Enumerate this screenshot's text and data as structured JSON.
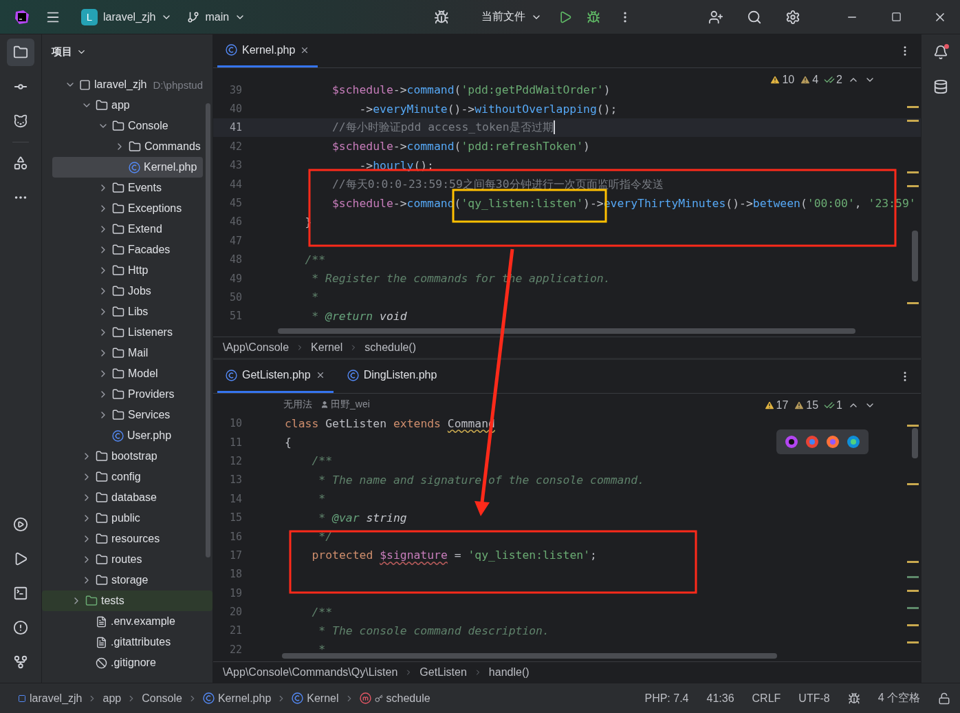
{
  "title_bar": {
    "project_badge": "L",
    "project": "laravel_zjh",
    "branch": "main",
    "run_config": "当前文件"
  },
  "project_panel": {
    "title": "项目",
    "tree": [
      {
        "name": "laravel_zjh",
        "path": "D:\\phpstud",
        "kind": "module",
        "expanded": true,
        "selected": false,
        "children": [
          {
            "name": "app",
            "kind": "folder",
            "expanded": true,
            "selected": false,
            "children": [
              {
                "name": "Console",
                "kind": "folder",
                "expanded": true,
                "selected": false,
                "children": [
                  {
                    "name": "Commands",
                    "kind": "folder",
                    "expanded": false,
                    "selected": false
                  },
                  {
                    "name": "Kernel.php",
                    "kind": "php-class",
                    "selected": true
                  }
                ]
              },
              {
                "name": "Events",
                "kind": "folder",
                "expanded": false,
                "selected": false
              },
              {
                "name": "Exceptions",
                "kind": "folder",
                "expanded": false,
                "selected": false
              },
              {
                "name": "Extend",
                "kind": "folder",
                "expanded": false,
                "selected": false
              },
              {
                "name": "Facades",
                "kind": "folder",
                "expanded": false,
                "selected": false
              },
              {
                "name": "Http",
                "kind": "folder",
                "expanded": false,
                "selected": false
              },
              {
                "name": "Jobs",
                "kind": "folder",
                "expanded": false,
                "selected": false
              },
              {
                "name": "Libs",
                "kind": "folder",
                "expanded": false,
                "selected": false
              },
              {
                "name": "Listeners",
                "kind": "folder",
                "expanded": false,
                "selected": false
              },
              {
                "name": "Mail",
                "kind": "folder",
                "expanded": false,
                "selected": false
              },
              {
                "name": "Model",
                "kind": "folder",
                "expanded": false,
                "selected": false
              },
              {
                "name": "Providers",
                "kind": "folder",
                "expanded": false,
                "selected": false
              },
              {
                "name": "Services",
                "kind": "folder",
                "expanded": false,
                "selected": false
              },
              {
                "name": "User.php",
                "kind": "php-class",
                "selected": false
              }
            ]
          },
          {
            "name": "bootstrap",
            "kind": "folder",
            "expanded": false,
            "selected": false
          },
          {
            "name": "config",
            "kind": "folder",
            "expanded": false,
            "selected": false
          },
          {
            "name": "database",
            "kind": "folder",
            "expanded": false,
            "selected": false
          },
          {
            "name": "public",
            "kind": "folder",
            "expanded": false,
            "selected": false
          },
          {
            "name": "resources",
            "kind": "folder",
            "expanded": false,
            "selected": false
          },
          {
            "name": "routes",
            "kind": "folder",
            "expanded": false,
            "selected": false
          },
          {
            "name": "storage",
            "kind": "folder",
            "expanded": false,
            "selected": false
          },
          {
            "name": "tests",
            "kind": "test-folder",
            "expanded": false,
            "selected": false
          },
          {
            "name": ".env.example",
            "kind": "text",
            "selected": false
          },
          {
            "name": ".gitattributes",
            "kind": "text",
            "selected": false
          },
          {
            "name": ".gitignore",
            "kind": "ignore",
            "selected": false
          }
        ]
      }
    ]
  },
  "editors": [
    {
      "tabs": [
        {
          "label": "Kernel.php",
          "selected": true
        }
      ],
      "inspections": {
        "warnings": "10",
        "weak_warnings": "4",
        "typos": "2"
      },
      "lines": [
        {
          "n": "39",
          "current": false,
          "tokens": [
            {
              "kind": "var",
              "t": "        $schedule"
            },
            {
              "kind": "plain",
              "t": "->"
            },
            {
              "kind": "method",
              "t": "command"
            },
            {
              "kind": "plain",
              "t": "("
            },
            {
              "kind": "string",
              "t": "'pdd:getPddWaitOrder'"
            },
            {
              "kind": "plain",
              "t": ")"
            }
          ]
        },
        {
          "n": "40",
          "current": false,
          "tokens": [
            {
              "kind": "plain",
              "t": "            ->"
            },
            {
              "kind": "method",
              "t": "everyMinute"
            },
            {
              "kind": "plain",
              "t": "()->"
            },
            {
              "kind": "method",
              "t": "withoutOverlapping"
            },
            {
              "kind": "plain",
              "t": "();"
            }
          ]
        },
        {
          "n": "41",
          "current": true,
          "tokens": [
            {
              "kind": "comment",
              "t": "        //每小时验证pdd access_token是否过期"
            }
          ]
        },
        {
          "n": "42",
          "current": false,
          "tokens": [
            {
              "kind": "var",
              "t": "        $schedule"
            },
            {
              "kind": "plain",
              "t": "->"
            },
            {
              "kind": "method",
              "t": "command"
            },
            {
              "kind": "plain",
              "t": "("
            },
            {
              "kind": "string",
              "t": "'pdd:refreshToken'"
            },
            {
              "kind": "plain",
              "t": ")"
            }
          ]
        },
        {
          "n": "43",
          "current": false,
          "tokens": [
            {
              "kind": "plain",
              "t": "            ->"
            },
            {
              "kind": "method",
              "t": "hourly"
            },
            {
              "kind": "plain",
              "t": "();"
            }
          ]
        },
        {
          "n": "44",
          "current": false,
          "tokens": [
            {
              "kind": "comment",
              "t": "        //每天0:0:0-23:59:59之间每30分钟进行一次页面监听指令发送"
            }
          ]
        },
        {
          "n": "45",
          "current": false,
          "tokens": [
            {
              "kind": "var",
              "t": "        $schedule"
            },
            {
              "kind": "plain",
              "t": "->"
            },
            {
              "kind": "method",
              "t": "command"
            },
            {
              "kind": "plain",
              "t": "("
            },
            {
              "kind": "string",
              "t": "'qy_listen:listen'"
            },
            {
              "kind": "plain",
              "t": ")->"
            },
            {
              "kind": "method",
              "t": "everyThirtyMinutes"
            },
            {
              "kind": "plain",
              "t": "()->"
            },
            {
              "kind": "method",
              "t": "between"
            },
            {
              "kind": "plain",
              "t": "("
            },
            {
              "kind": "string",
              "t": "'00:00'"
            },
            {
              "kind": "plain",
              "t": ", "
            },
            {
              "kind": "string",
              "t": "'23:59'"
            }
          ]
        },
        {
          "n": "46",
          "current": false,
          "tokens": [
            {
              "kind": "plain",
              "t": "    }"
            }
          ]
        },
        {
          "n": "47",
          "current": false
        },
        {
          "n": "48",
          "current": false,
          "tokens": [
            {
              "kind": "doc",
              "t": "    /**"
            }
          ]
        },
        {
          "n": "49",
          "current": false,
          "tokens": [
            {
              "kind": "doc",
              "t": "     * Register the commands for the application."
            }
          ]
        },
        {
          "n": "50",
          "current": false,
          "tokens": [
            {
              "kind": "doc",
              "t": "     *"
            }
          ]
        },
        {
          "n": "51",
          "current": false,
          "tokens": [
            {
              "kind": "doc",
              "t": "     * "
            },
            {
              "kind": "doctag",
              "t": "@return"
            },
            {
              "kind": "doctype",
              "t": " void"
            }
          ]
        }
      ],
      "breadcrumbs": [
        "\\App\\Console",
        "Kernel",
        "schedule()"
      ]
    },
    {
      "tabs": [
        {
          "label": "GetListen.php",
          "selected": true
        },
        {
          "label": "DingListen.php",
          "selected": false
        }
      ],
      "inspections": {
        "warnings": "17",
        "weak_warnings": "15",
        "typos": "1"
      },
      "author_hint": {
        "usages": "无用法",
        "author": "田野_wei"
      },
      "browser_bar": true,
      "lines": [
        {
          "n": "10",
          "current": false,
          "tokens": [
            {
              "kind": "keyword",
              "t": "class"
            },
            {
              "kind": "plain",
              "t": " GetListen "
            },
            {
              "kind": "keyword",
              "t": "extends "
            },
            {
              "kind": "class-warn",
              "t": "Command"
            }
          ]
        },
        {
          "n": "11",
          "current": false,
          "tokens": [
            {
              "kind": "plain",
              "t": "{"
            }
          ]
        },
        {
          "n": "12",
          "current": false,
          "tokens": [
            {
              "kind": "doc",
              "t": "    /**"
            }
          ]
        },
        {
          "n": "13",
          "current": false,
          "tokens": [
            {
              "kind": "doc",
              "t": "     * The name and signature of the console command."
            }
          ]
        },
        {
          "n": "14",
          "current": false,
          "tokens": [
            {
              "kind": "doc",
              "t": "     *"
            }
          ]
        },
        {
          "n": "15",
          "current": false,
          "tokens": [
            {
              "kind": "doc",
              "t": "     * "
            },
            {
              "kind": "doctag",
              "t": "@var"
            },
            {
              "kind": "doctype",
              "t": " string"
            }
          ]
        },
        {
          "n": "16",
          "current": false,
          "tokens": [
            {
              "kind": "doc",
              "t": "     */"
            }
          ]
        },
        {
          "n": "17",
          "current": false,
          "tokens": [
            {
              "kind": "keyword",
              "t": "    protected "
            },
            {
              "kind": "var-warn",
              "t": "$signature"
            },
            {
              "kind": "plain",
              "t": " = "
            },
            {
              "kind": "string",
              "t": "'qy_listen:listen'"
            },
            {
              "kind": "plain",
              "t": ";"
            }
          ]
        },
        {
          "n": "18",
          "current": false
        },
        {
          "n": "19",
          "current": false
        },
        {
          "n": "20",
          "current": false,
          "tokens": [
            {
              "kind": "doc",
              "t": "    /**"
            }
          ]
        },
        {
          "n": "21",
          "current": false,
          "tokens": [
            {
              "kind": "doc",
              "t": "     * The console command description."
            }
          ]
        },
        {
          "n": "22",
          "current": false,
          "tokens": [
            {
              "kind": "doc",
              "t": "     *"
            }
          ]
        }
      ],
      "breadcrumbs": [
        "\\App\\Console\\Commands\\Qy\\Listen",
        "GetListen",
        "handle()"
      ]
    }
  ],
  "status_bar": {
    "path": [
      {
        "label": "laravel_zjh",
        "kind": "module"
      },
      {
        "label": "app",
        "kind": "folder"
      },
      {
        "label": "Console",
        "kind": "folder"
      },
      {
        "label": "Kernel.php",
        "kind": "class"
      },
      {
        "label": "Kernel",
        "kind": "class"
      },
      {
        "label": "schedule",
        "kind": "method"
      }
    ],
    "items": [
      "PHP: 7.4",
      "41:36",
      "CRLF",
      "UTF-8"
    ],
    "indent": "4 个空格"
  }
}
